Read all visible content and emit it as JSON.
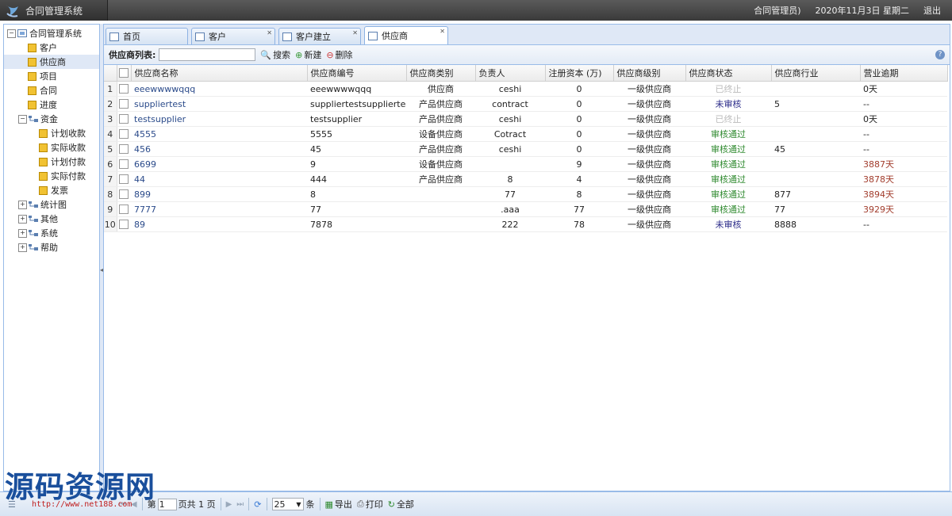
{
  "header": {
    "app_title": "合同管理系统",
    "user": "合同管理员)",
    "date": "2020年11月3日 星期二",
    "logout": "退出"
  },
  "sidebar": {
    "root": "合同管理系统",
    "items": [
      {
        "label": "客户",
        "level": 1,
        "type": "page"
      },
      {
        "label": "供应商",
        "level": 1,
        "type": "page",
        "selected": true
      },
      {
        "label": "项目",
        "level": 1,
        "type": "page"
      },
      {
        "label": "合同",
        "level": 1,
        "type": "page"
      },
      {
        "label": "进度",
        "level": 1,
        "type": "page"
      },
      {
        "label": "资金",
        "level": 0,
        "type": "folder",
        "expanded": true
      },
      {
        "label": "计划收款",
        "level": 2,
        "type": "page"
      },
      {
        "label": "实际收款",
        "level": 2,
        "type": "page"
      },
      {
        "label": "计划付款",
        "level": 2,
        "type": "page"
      },
      {
        "label": "实际付款",
        "level": 2,
        "type": "page"
      },
      {
        "label": "发票",
        "level": 2,
        "type": "page"
      },
      {
        "label": "统计图",
        "level": 0,
        "type": "folder",
        "expanded": false
      },
      {
        "label": "其他",
        "level": 0,
        "type": "folder",
        "expanded": false
      },
      {
        "label": "系统",
        "level": 0,
        "type": "folder",
        "expanded": false
      },
      {
        "label": "帮助",
        "level": 0,
        "type": "folder",
        "expanded": false
      }
    ]
  },
  "tabs": [
    {
      "label": "首页",
      "closable": false
    },
    {
      "label": "客户",
      "closable": true
    },
    {
      "label": "客户建立",
      "closable": true
    },
    {
      "label": "供应商",
      "closable": true,
      "active": true
    }
  ],
  "toolbar": {
    "list_label": "供应商列表:",
    "search_value": "",
    "search_label": "搜索",
    "new_label": "新建",
    "delete_label": "删除"
  },
  "grid": {
    "columns": [
      "供应商名称",
      "供应商编号",
      "供应商类别",
      "负责人",
      "注册资本 (万)",
      "供应商级别",
      "供应商状态",
      "供应商行业",
      "营业逾期"
    ],
    "rows": [
      [
        "1",
        "eeewwwwqqq",
        "eeewwwwqqq",
        "供应商",
        "ceshi",
        "0",
        "一级供应商",
        "已终止",
        "",
        "0天"
      ],
      [
        "2",
        "suppliertest",
        "suppliertestsuppliertest",
        "产品供应商",
        "contract",
        "0",
        "一级供应商",
        "未审核",
        "5",
        "--"
      ],
      [
        "3",
        "testsupplier",
        "testsupplier",
        "产品供应商",
        "ceshi",
        "0",
        "一级供应商",
        "已终止",
        "",
        "0天"
      ],
      [
        "4",
        "4555",
        "5555",
        "设备供应商",
        "Cotract",
        "0",
        "一级供应商",
        "审核通过",
        "",
        "--"
      ],
      [
        "5",
        "456",
        "45",
        "产品供应商",
        "ceshi",
        "0",
        "一级供应商",
        "审核通过",
        "45",
        "--"
      ],
      [
        "6",
        "6699",
        "9",
        "设备供应商",
        "",
        "9",
        "一级供应商",
        "审核通过",
        "",
        "3887天"
      ],
      [
        "7",
        "44",
        "444",
        "产品供应商",
        "8",
        "4",
        "一级供应商",
        "审核通过",
        "",
        "3878天"
      ],
      [
        "8",
        "899",
        "8",
        "",
        "77",
        "8",
        "一级供应商",
        "审核通过",
        "877",
        "3894天"
      ],
      [
        "9",
        "7777",
        "77",
        "",
        ".aaa",
        "77",
        "一级供应商",
        "审核通过",
        "77",
        "3929天"
      ],
      [
        "10",
        "89",
        "7878",
        "",
        "222",
        "78",
        "一级供应商",
        "未审核",
        "8888",
        "--"
      ]
    ]
  },
  "pagebar": {
    "page_prefix": "第",
    "page_value": "1",
    "page_suffix": "页共 1 页",
    "page_size": "25",
    "page_size_unit": "条",
    "export_label": "导出",
    "print_label": "打印",
    "all_label": "全部"
  },
  "watermark": {
    "title": "源码资源网",
    "url": "http://www.net188.com"
  },
  "colors": {
    "accent": "#99bbe8",
    "status_pass": "#2f8a2f",
    "status_pending": "#2a2a88",
    "status_stopped": "#bbbbbb",
    "overdue": "#a23d2d"
  }
}
